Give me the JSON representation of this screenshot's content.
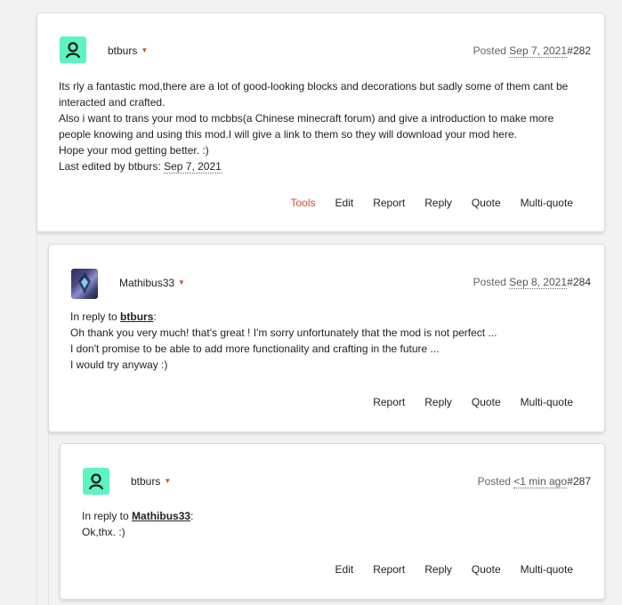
{
  "posts": [
    {
      "author": "btburs",
      "posted_label": "Posted",
      "date": "Sep 7, 2021",
      "number": "#282",
      "lines": [
        "Its rly a fantastic mod,there are a lot of good-looking blocks and decorations but sadly some of them cant be interacted and crafted.",
        "Also i want to trans your mod to mcbbs(a Chinese minecraft forum) and give a introduction to make more people knowing and using this mod.I will give a link to them so they will download your mod here.",
        "Hope your mod getting better. :)"
      ],
      "edited_label": "Last edited by btburs:",
      "edited_date": "Sep 7, 2021",
      "actions": {
        "tools": "Tools",
        "edit": "Edit",
        "report": "Report",
        "reply": "Reply",
        "quote": "Quote",
        "multiquote": "Multi-quote"
      }
    },
    {
      "author": "Mathibus33",
      "posted_label": "Posted",
      "date": "Sep 8, 2021",
      "number": "#284",
      "reply_label": "In reply to",
      "reply_to": "btburs",
      "reply_suffix": ":",
      "lines": [
        "Oh thank you very much! that's great ! I'm sorry unfortunately that the mod is not perfect ...",
        "I don't promise to be able to add more functionality and crafting in the future ...",
        "I would try anyway :)"
      ],
      "actions": {
        "report": "Report",
        "reply": "Reply",
        "quote": "Quote",
        "multiquote": "Multi-quote"
      }
    },
    {
      "author": "btburs",
      "posted_label": "Posted",
      "date": "<1 min ago",
      "number": "#287",
      "reply_label": "In reply to",
      "reply_to": "Mathibus33",
      "reply_suffix": ":",
      "lines": [
        "Ok,thx. :)"
      ],
      "actions": {
        "edit": "Edit",
        "report": "Report",
        "reply": "Reply",
        "quote": "Quote",
        "multiquote": "Multi-quote"
      }
    }
  ],
  "colors": {
    "avatar_bg": "#5cf4c0",
    "accent": "#c8502a"
  },
  "icons": {
    "default_avatar": "user-silhouette-icon",
    "dropdown": "caret-down-icon"
  }
}
